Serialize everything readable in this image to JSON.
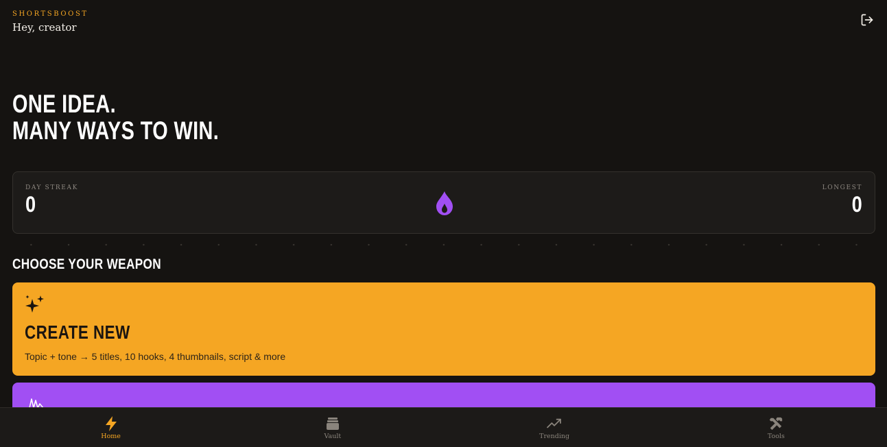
{
  "header": {
    "brand": "SHORTSBOOST",
    "greeting": "Hey, creator"
  },
  "hero": {
    "line1": "ONE IDEA.",
    "line2": "MANY WAYS TO WIN."
  },
  "streak": {
    "day_label": "DAY STREAK",
    "day_value": "0",
    "longest_label": "LONGEST",
    "longest_value": "0"
  },
  "section": {
    "title": "CHOOSE YOUR WEAPON"
  },
  "cards": [
    {
      "title": "CREATE NEW",
      "description": "Topic + tone → 5 titles, 10 hooks, 4 thumbnails, script & more",
      "icon": "sparkles-icon",
      "color": "#f5a623"
    },
    {
      "icon": "waveform-icon",
      "color": "#a14ff3"
    }
  ],
  "nav": {
    "items": [
      {
        "label": "Home",
        "icon": "bolt-icon",
        "active": true
      },
      {
        "label": "Vault",
        "icon": "archive-icon",
        "active": false
      },
      {
        "label": "Trending",
        "icon": "trending-up-icon",
        "active": false
      },
      {
        "label": "Tools",
        "icon": "tools-icon",
        "active": false
      }
    ]
  },
  "colors": {
    "background": "#151311",
    "accent": "#f5a623",
    "purple": "#a14ff3"
  }
}
